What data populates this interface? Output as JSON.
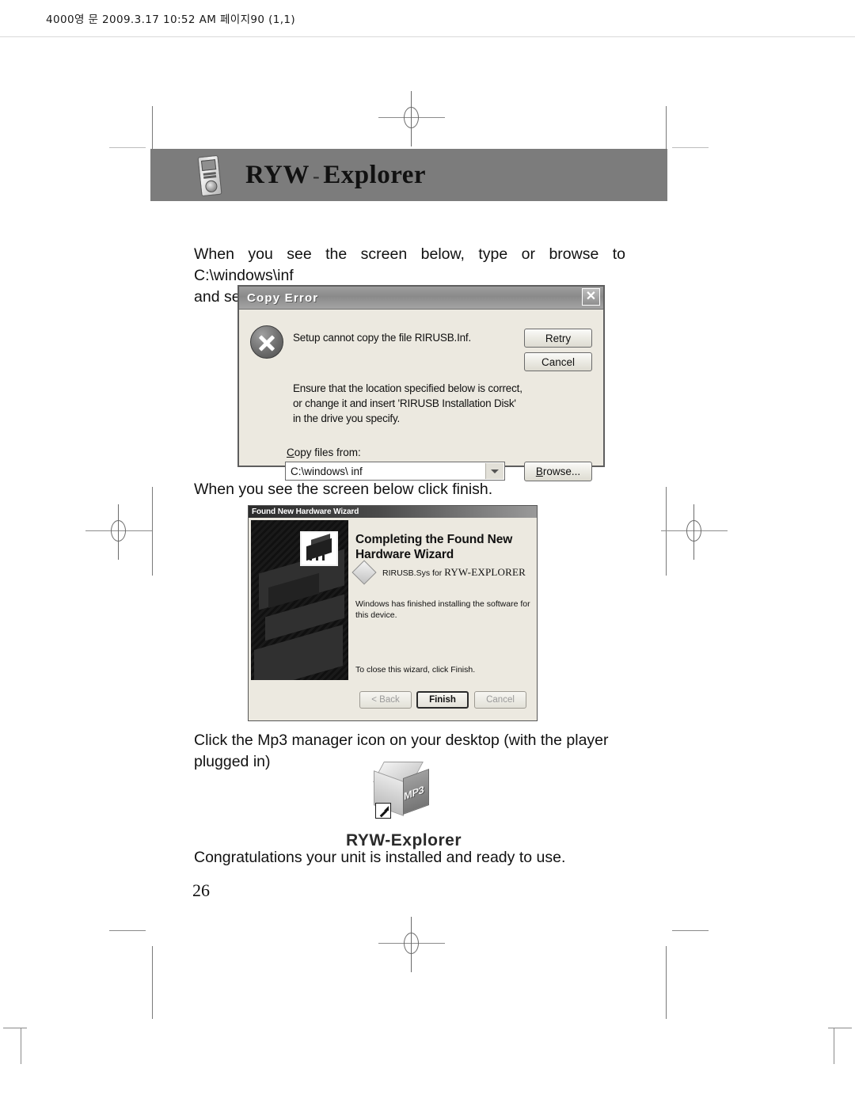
{
  "print_header": {
    "text": "4000영 문  2009.3.17 10:52 AM  페이지90 (1,1)"
  },
  "page_title": {
    "brand": "RYW",
    "dash": "-",
    "name": "Explorer",
    "device_icon": "mp3-player-icon"
  },
  "instructions": {
    "step1_line1": "When you see the screen below, type or browse to C:\\windows\\inf",
    "step1_line2": "and select retry",
    "step2": "When you see the screen below click finish.",
    "step3_line1": "Click the Mp3 manager icon on your desktop (with the player",
    "step3_line2": "plugged in)",
    "step4": "Congratulations your unit is installed and ready to use."
  },
  "copy_error_dialog": {
    "title": "Copy Error",
    "close_label": "✕",
    "error_icon": "error-x-circle-icon",
    "message_primary": "Setup cannot copy the file RIRUSB.Inf.",
    "message_secondary": "Ensure that the location specified below is correct, or change it and insert 'RIRUSB Installation Disk' in the drive you specify.",
    "copy_from_label_underlined": "C",
    "copy_from_label_rest": "opy files from:",
    "path_value": "C:\\windows\\ inf",
    "dropdown_icon": "chevron-down-icon",
    "retry_button": "Retry",
    "cancel_button": "Cancel",
    "browse_button_underlined": "B",
    "browse_button_rest": "rowse..."
  },
  "hardware_wizard": {
    "title": "Found New Hardware Wizard",
    "banner_icon": "hardware-chip-icon",
    "heading_line1": "Completing the Found New",
    "heading_line2": "Hardware Wizard",
    "device_prefix": "RIRUSB.Sys for ",
    "device_name": "RYW-EXPLORER",
    "device_icon": "diamond-device-icon",
    "finished_text": "Windows has finished installing the software for this device.",
    "close_note": "To close this wizard, click Finish.",
    "back_button": "< Back",
    "finish_button": "Finish",
    "cancel_button": "Cancel"
  },
  "desktop_shortcut": {
    "icon_name": "mp3-box-shortcut-icon",
    "box_label": "MP3",
    "shortcut_badge": "shortcut-arrow-icon",
    "label": "RYW-Explorer"
  },
  "footer": {
    "page_number": "26"
  },
  "marks": {
    "registration_icon": "registration-crosshair-icon",
    "crop_icon": "crop-mark-icon"
  }
}
